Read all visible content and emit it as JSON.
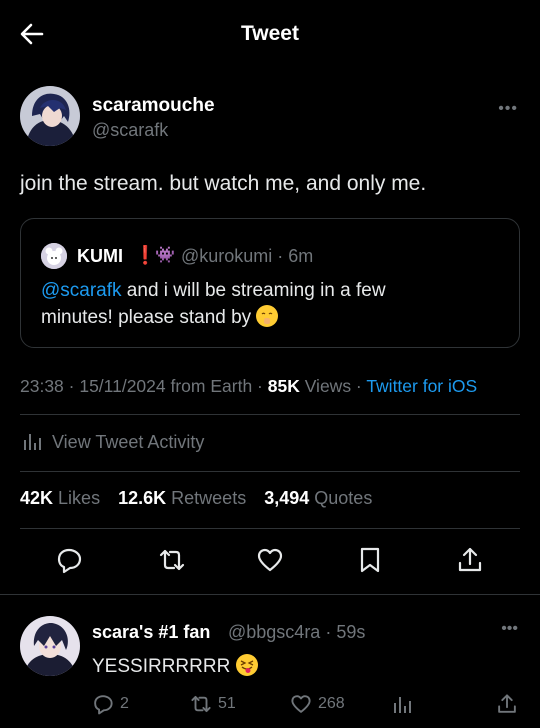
{
  "header": {
    "title": "Tweet",
    "back_icon": "arrow-left-icon"
  },
  "tweet": {
    "author_name": "scaramouche",
    "author_handle": "@scarafk",
    "text": "join the stream. but watch me, and only me.",
    "quote": {
      "name": "KUMI",
      "badge1": "❗",
      "badge2": "👾",
      "handle_time": "@kurokumi · 6m",
      "mention": "@scarafk",
      "text": " and i will be streaming in a few minutes! please stand by ",
      "emoji": "shushing-face-emoji"
    },
    "time": "23:38 · 15/11/2024 from Earth · ",
    "views_count": "85K",
    "views_label": " Views · ",
    "source": "Twitter for iOS"
  },
  "activity": {
    "label": "View Tweet Activity"
  },
  "stats": {
    "likes_count": "42K",
    "likes_label": "Likes",
    "retweets_count": "12.6K",
    "retweets_label": "Retweets",
    "quotes_count": "3,494",
    "quotes_label": "Quotes"
  },
  "reply": {
    "name": "scara's #1 fan",
    "handle_time": "@bbgsc4ra · 59s",
    "text": "YESSIRRRRRR",
    "emoji": "squinting-tongue-emoji",
    "replies": "2",
    "retweets": "51",
    "likes": "268"
  },
  "colors": {
    "accent": "#1d9bf0",
    "muted": "#71767b",
    "bg": "#000000",
    "border": "#2f3336"
  }
}
